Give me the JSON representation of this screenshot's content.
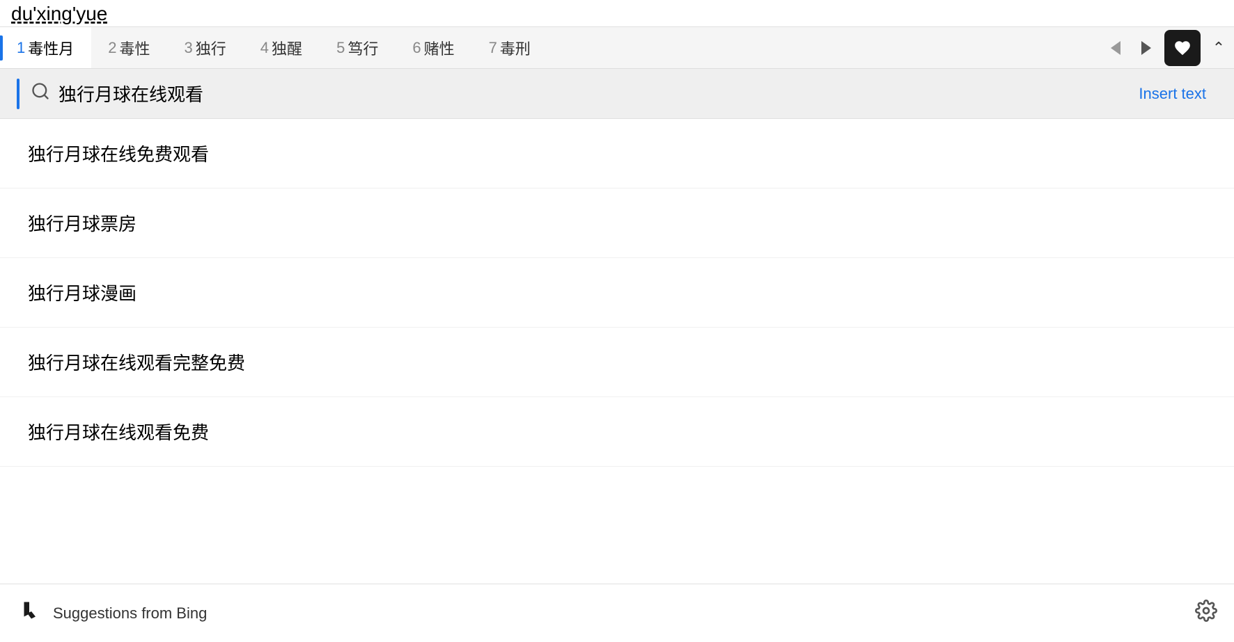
{
  "input": {
    "value": "du'xing'yue"
  },
  "tabs": [
    {
      "number": "1",
      "label": "毒性月",
      "active": true
    },
    {
      "number": "2",
      "label": "毒性",
      "active": false
    },
    {
      "number": "3",
      "label": "独行",
      "active": false
    },
    {
      "number": "4",
      "label": "独醒",
      "active": false
    },
    {
      "number": "5",
      "label": "笃行",
      "active": false
    },
    {
      "number": "6",
      "label": "赌性",
      "active": false
    },
    {
      "number": "7",
      "label": "毒刑",
      "active": false
    }
  ],
  "search": {
    "query": "独行月球在线观看",
    "insert_text_label": "Insert text"
  },
  "suggestions": [
    {
      "text": "独行月球在线免费观看"
    },
    {
      "text": "独行月球票房"
    },
    {
      "text": "独行月球漫画"
    },
    {
      "text": "独行月球在线观看完整免费"
    },
    {
      "text": "独行月球在线观看免费"
    }
  ],
  "footer": {
    "bing_label": "Suggestions from Bing",
    "settings_label": "Settings"
  }
}
